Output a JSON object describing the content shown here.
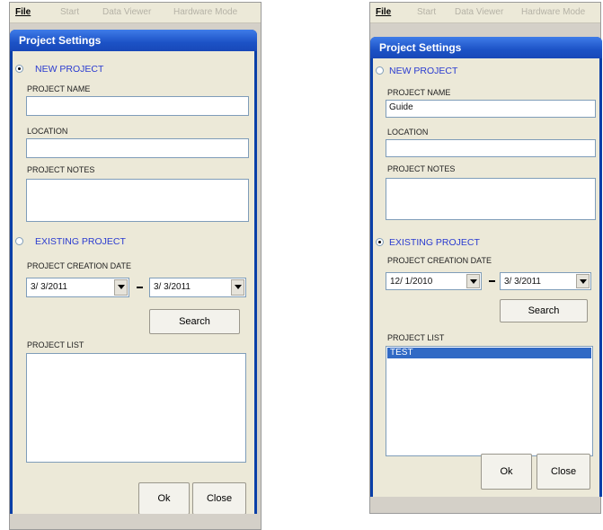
{
  "screens": [
    {
      "menu": {
        "file": "File",
        "start": "Start",
        "data_viewer": "Data Viewer",
        "hardware_mode": "Hardware Mode"
      },
      "dialog_title": "Project Settings",
      "new_project": {
        "label": "NEW PROJECT",
        "selected": true
      },
      "project_name": {
        "label": "PROJECT NAME",
        "value": ""
      },
      "location": {
        "label": "LOCATION",
        "value": ""
      },
      "project_notes": {
        "label": "PROJECT NOTES",
        "value": ""
      },
      "existing_project": {
        "label": "EXISTING PROJECT",
        "selected": false
      },
      "creation_date": {
        "label": "PROJECT CREATION DATE",
        "from": "3/ 3/2011",
        "dash": "-",
        "to": "3/ 3/2011"
      },
      "search_label": "Search",
      "project_list": {
        "label": "PROJECT LIST",
        "items": []
      },
      "ok_label": "Ok",
      "close_label": "Close"
    },
    {
      "menu": {
        "file": "File",
        "start": "Start",
        "data_viewer": "Data Viewer",
        "hardware_mode": "Hardware Mode"
      },
      "dialog_title": "Project Settings",
      "new_project": {
        "label": "NEW PROJECT",
        "selected": false
      },
      "project_name": {
        "label": "PROJECT NAME",
        "value": "Guide"
      },
      "location": {
        "label": "LOCATION",
        "value": ""
      },
      "project_notes": {
        "label": "PROJECT NOTES",
        "value": ""
      },
      "existing_project": {
        "label": "EXISTING PROJECT",
        "selected": true
      },
      "creation_date": {
        "label": "PROJECT CREATION DATE",
        "from": "12/ 1/2010",
        "dash": "-",
        "to": "3/ 3/2011"
      },
      "search_label": "Search",
      "project_list": {
        "label": "PROJECT LIST",
        "items": [
          "TEST"
        ]
      },
      "ok_label": "Ok",
      "close_label": "Close"
    }
  ],
  "colors": {
    "title_bar": "#1c52c6",
    "radio_label": "#2a3bd0",
    "selection": "#316ac5"
  }
}
